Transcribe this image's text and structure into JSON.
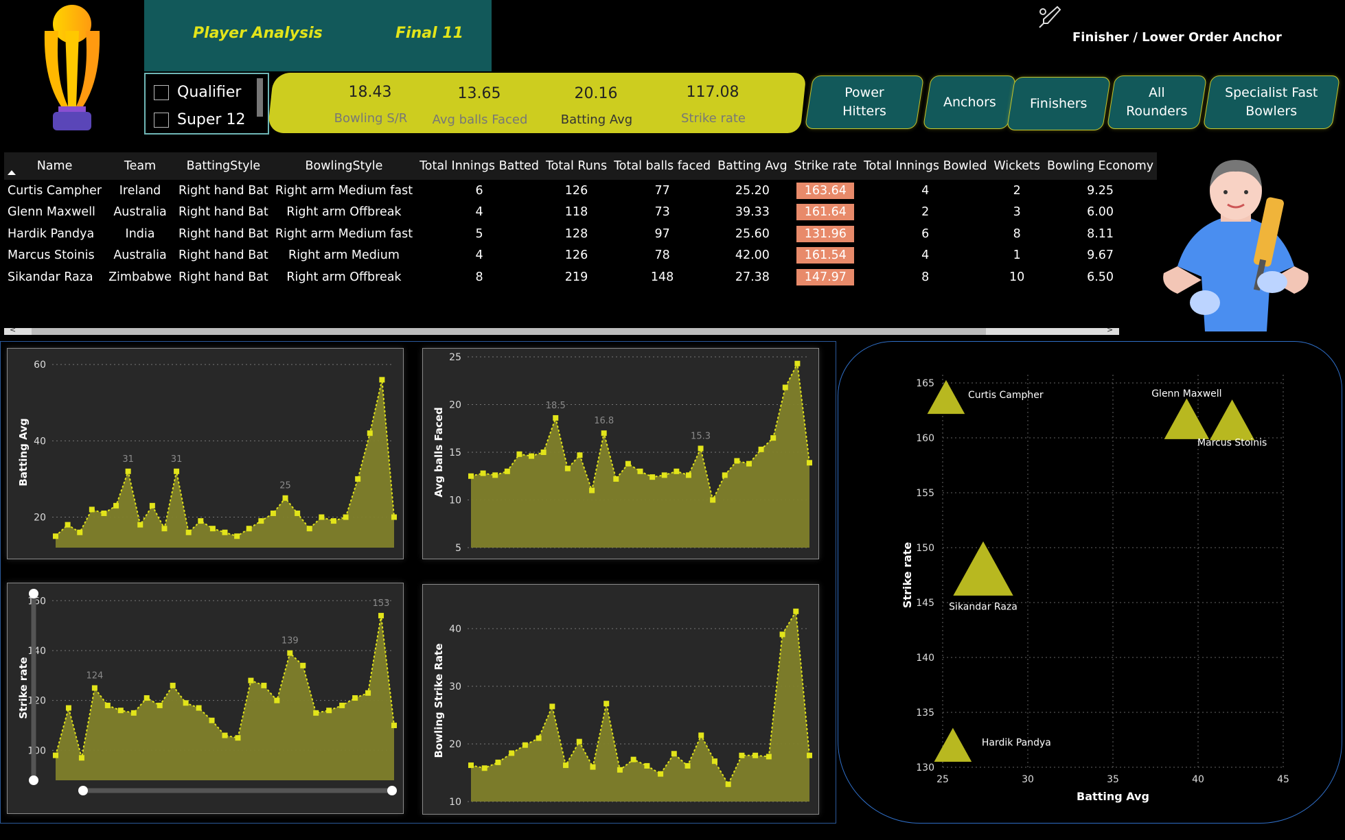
{
  "header": {
    "tabs": [
      {
        "label": "Player Analysis"
      },
      {
        "label": "Final 11"
      }
    ],
    "filters": [
      {
        "label": "Qualifier",
        "checked": false
      },
      {
        "label": "Super 12",
        "checked": false
      }
    ],
    "kpis": [
      {
        "value": "18.43",
        "label": "Bowling S/R"
      },
      {
        "value": "13.65",
        "label": "Avg balls Faced"
      },
      {
        "value": "20.16",
        "label": "Batting Avg"
      },
      {
        "value": "117.08",
        "label": "Strike rate"
      }
    ],
    "role_buttons": [
      {
        "label": "Power\nHitters"
      },
      {
        "label": "Anchors"
      },
      {
        "label": "Finishers"
      },
      {
        "label": "All\nRounders"
      },
      {
        "label": "Specialist Fast\nBowlers"
      }
    ],
    "role_title": "Finisher / Lower Order Anchor"
  },
  "table": {
    "columns": [
      "Name",
      "Team",
      "BattingStyle",
      "BowlingStyle",
      "Total Innings Batted",
      "Total Runs",
      "Total balls faced",
      "Batting Avg",
      "Strike rate",
      "Total Innings Bowled",
      "Wickets",
      "Bowling Economy"
    ],
    "rows": [
      [
        "Curtis Campher",
        "Ireland",
        "Right hand Bat",
        "Right arm Medium fast",
        "6",
        "126",
        "77",
        "25.20",
        "163.64",
        "4",
        "2",
        "9.25"
      ],
      [
        "Glenn Maxwell",
        "Australia",
        "Right hand Bat",
        "Right arm Offbreak",
        "4",
        "118",
        "73",
        "39.33",
        "161.64",
        "2",
        "3",
        "6.00"
      ],
      [
        "Hardik Pandya",
        "India",
        "Right hand Bat",
        "Right arm Medium fast",
        "5",
        "128",
        "97",
        "25.60",
        "131.96",
        "6",
        "8",
        "8.11"
      ],
      [
        "Marcus Stoinis",
        "Australia",
        "Right hand Bat",
        "Right arm Medium",
        "4",
        "126",
        "78",
        "42.00",
        "161.54",
        "4",
        "1",
        "9.67"
      ],
      [
        "Sikandar Raza",
        "Zimbabwe",
        "Right hand Bat",
        "Right arm Offbreak",
        "8",
        "219",
        "148",
        "27.38",
        "147.97",
        "8",
        "10",
        "6.50"
      ]
    ],
    "highlight_color": "#e88a6a"
  },
  "colors": {
    "accent": "#cdcd1f",
    "teal": "#12595a",
    "area_fill": "#7f7f2a",
    "line": "#e2e41a"
  },
  "chart_data": [
    {
      "type": "area",
      "ylabel": "Batting Avg",
      "ylim": [
        12,
        62
      ],
      "yticks": [
        20,
        40,
        60
      ],
      "values": [
        15,
        18,
        16,
        22,
        21,
        23,
        32,
        18,
        23,
        17,
        32,
        16,
        19,
        17,
        16,
        15,
        17,
        19,
        21,
        25,
        21,
        17,
        20,
        19,
        20,
        30,
        42,
        56,
        20
      ],
      "data_labels": [
        {
          "index": 6,
          "text": "31"
        },
        {
          "index": 10,
          "text": "31"
        },
        {
          "index": 19,
          "text": "25"
        }
      ]
    },
    {
      "type": "area",
      "ylabel": "Avg balls Faced",
      "ylim": [
        5,
        25
      ],
      "yticks": [
        5,
        10,
        15,
        20,
        25
      ],
      "values": [
        12.5,
        12.8,
        12.6,
        13,
        14.8,
        14.6,
        15,
        18.6,
        13.3,
        14.7,
        11,
        17,
        12.2,
        13.8,
        13,
        12.4,
        12.6,
        13,
        12.6,
        15.4,
        10,
        12.6,
        14.1,
        13.8,
        15.3,
        16.5,
        21.8,
        24.3,
        13.9
      ],
      "data_labels": [
        {
          "index": 7,
          "text": "18.5"
        },
        {
          "index": 11,
          "text": "16.8"
        },
        {
          "index": 19,
          "text": "15.3"
        }
      ]
    },
    {
      "type": "area",
      "ylabel": "Strike rate",
      "ylim": [
        88,
        162
      ],
      "yticks": [
        100,
        120,
        140,
        160
      ],
      "values": [
        98,
        117,
        97,
        125,
        118,
        116,
        115,
        121,
        118,
        126,
        119,
        117,
        112,
        106,
        105,
        128,
        126,
        120,
        139,
        134,
        115,
        116,
        118,
        121,
        123,
        154,
        110
      ],
      "data_labels": [
        {
          "index": 3,
          "text": "124"
        },
        {
          "index": 18,
          "text": "139"
        },
        {
          "index": 25,
          "text": "153"
        }
      ]
    },
    {
      "type": "area",
      "ylabel": "Bowling Strike Rate",
      "ylim": [
        10,
        45
      ],
      "yticks": [
        10,
        20,
        30,
        40
      ],
      "values": [
        16.3,
        15.8,
        16.8,
        18.4,
        19.8,
        21,
        26.5,
        16.3,
        20.4,
        16,
        27,
        15.5,
        17.3,
        16.2,
        14.8,
        18.3,
        16.2,
        21.5,
        17,
        13,
        18,
        18,
        17.8,
        39,
        43,
        18
      ]
    },
    {
      "type": "scatter",
      "xlabel": "Batting Avg",
      "ylabel": "Strike rate",
      "xlim": [
        25,
        45
      ],
      "ylim": [
        130,
        165
      ],
      "xticks": [
        25,
        30,
        35,
        40,
        45
      ],
      "yticks": [
        130,
        135,
        140,
        145,
        150,
        155,
        160,
        165
      ],
      "points": [
        {
          "x": 25.2,
          "y": 163.64,
          "label": "Curtis Campher",
          "size": 1
        },
        {
          "x": 39.33,
          "y": 161.64,
          "label": "Glenn Maxwell",
          "size": 1.2
        },
        {
          "x": 25.6,
          "y": 131.96,
          "label": "Hardik Pandya",
          "size": 1
        },
        {
          "x": 42.0,
          "y": 161.54,
          "label": "Marcus Stoinis",
          "size": 1.2
        },
        {
          "x": 27.38,
          "y": 147.97,
          "label": "Sikandar Raza",
          "size": 1.6
        }
      ]
    }
  ]
}
